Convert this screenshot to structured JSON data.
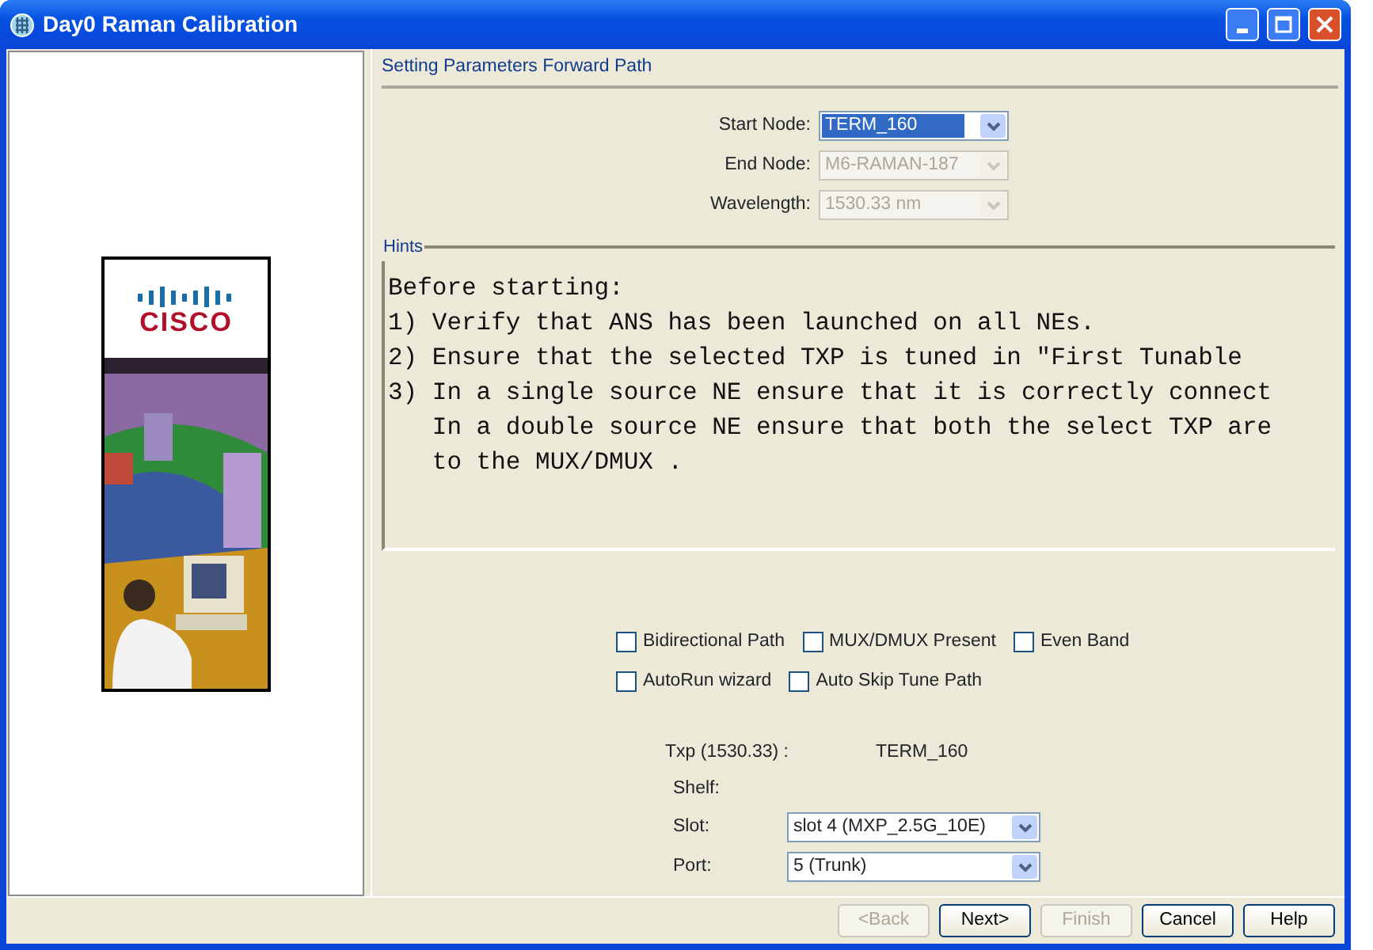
{
  "window": {
    "title": "Day0 Raman Calibration"
  },
  "sidebar": {
    "logo_text": "CISCO"
  },
  "section_title": "Setting Parameters Forward Path",
  "path_fields": [
    {
      "label": "Start Node:",
      "value": "TERM_160",
      "disabled": false,
      "selected": true
    },
    {
      "label": "End Node:",
      "value": "M6-RAMAN-187",
      "disabled": true,
      "selected": false
    },
    {
      "label": "Wavelength:",
      "value": "1530.33 nm",
      "disabled": true,
      "selected": false
    }
  ],
  "hints": {
    "legend": "Hints",
    "lines": [
      "Before starting:",
      "1) Verify that ANS has been launched on all NEs.",
      "2) Ensure that the selected TXP is tuned in \"First Tunable",
      "3) In a single source NE ensure that it is correctly connect",
      "   In a double source NE ensure that both the select TXP are",
      "   to the MUX/DMUX ."
    ]
  },
  "option_rows": [
    [
      {
        "label": "Bidirectional Path",
        "checked": false
      },
      {
        "label": "MUX/DMUX Present",
        "checked": false
      },
      {
        "label": "Even Band",
        "checked": false
      }
    ],
    [
      {
        "label": "AutoRun wizard",
        "checked": false
      },
      {
        "label": "Auto Skip Tune Path",
        "checked": false
      }
    ]
  ],
  "txp": {
    "label": "Txp (1530.33) :",
    "value": "TERM_160"
  },
  "shelf": {
    "label": "Shelf:"
  },
  "port_fields": [
    {
      "label": "Slot:",
      "value": "slot  4 (MXP_2.5G_10E)"
    },
    {
      "label": "Port:",
      "value": "5 (Trunk)"
    }
  ],
  "buttons": [
    {
      "label": "<Back",
      "disabled": true
    },
    {
      "label": "Next>",
      "disabled": false
    },
    {
      "label": "Finish",
      "disabled": true
    },
    {
      "label": "Cancel",
      "disabled": false
    },
    {
      "label": "Help",
      "disabled": false
    }
  ]
}
